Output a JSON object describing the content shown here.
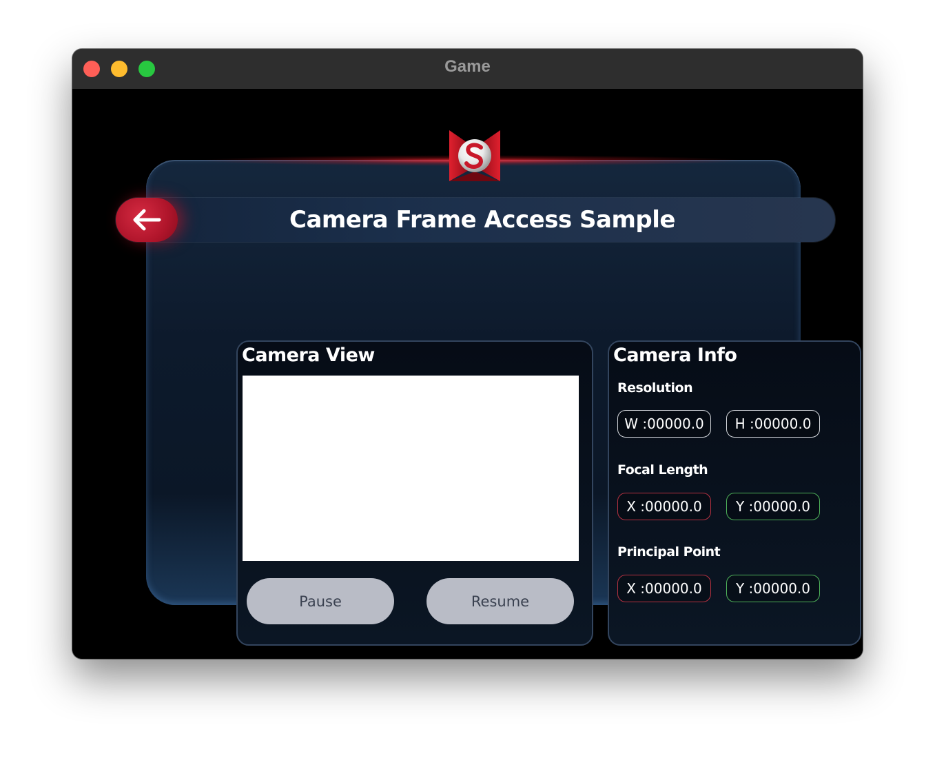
{
  "window": {
    "title": "Game"
  },
  "header": {
    "title": "Camera Frame Access Sample",
    "back_icon": "arrow-left-icon"
  },
  "camera_view": {
    "title": "Camera View",
    "pause_label": "Pause",
    "resume_label": "Resume"
  },
  "camera_info": {
    "title": "Camera Info",
    "resolution": {
      "label": "Resolution",
      "w": "W :00000.0",
      "h": "H :00000.0"
    },
    "focal_length": {
      "label": "Focal Length",
      "x": "X :00000.0",
      "y": "Y :00000.0"
    },
    "principal_point": {
      "label": "Principal Point",
      "x": "X :00000.0",
      "y": "Y :00000.0"
    }
  },
  "colors": {
    "accent_red": "#b0152b",
    "panel_blue": "#15273d",
    "button_gray": "#b9bcc6",
    "x_border": "#b83242",
    "y_border": "#4fb35a"
  }
}
